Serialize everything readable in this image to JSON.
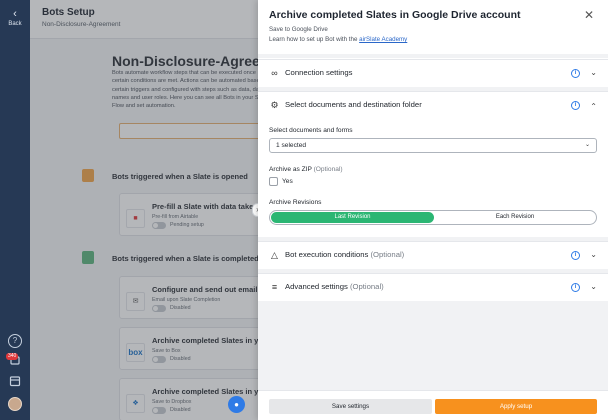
{
  "rail": {
    "back_label": "Back",
    "notif_count": "340"
  },
  "page": {
    "title": "Bots Setup",
    "subtitle": "Non-Disclosure-Agreement",
    "intro_title": "Non-Disclosure-Agreement",
    "intro_text": "Bots automate workflow steps that can be executed once certain conditions are met. Actions can be automated based on certain triggers and configured with steps such as data, dates, names and user roles. Here you can see all Bots in your Slate Flow and set automation.",
    "add_button": "Ad"
  },
  "triggers": [
    {
      "label": "Bots triggered when a Slate is opened",
      "color": "#f2a54a"
    },
    {
      "label": "Bots triggered when a Slate is completed",
      "color": "#5db57e"
    }
  ],
  "bots": [
    {
      "name": "Pre-fill a Slate with data taken",
      "desc": "Pre-fill from Airtable",
      "status": "Pending setup",
      "icon": "airtable-icon"
    },
    {
      "name": "Configure and send out email",
      "desc": "Email upon Slate Completion",
      "status": "Disabled",
      "icon": "mail-icon"
    },
    {
      "name": "Archive completed Slates in yo",
      "desc": "Save to Box",
      "status": "Disabled",
      "icon": "box-icon",
      "icon_text": "box"
    },
    {
      "name": "Archive completed Slates in yo",
      "desc": "Save to Dropbox",
      "status": "Disabled",
      "icon": "dropbox-icon"
    }
  ],
  "drawer": {
    "title": "Archive completed Slates in Google Drive account",
    "subtitle": "Save to Google Drive",
    "learn_prefix": "Learn how to set up Bot with the ",
    "learn_link": "airSlate Academy",
    "sections": {
      "connection": "Connection settings",
      "select_docs": "Select documents and destination folder",
      "bot_exec": "Bot execution conditions",
      "bot_exec_opt": "(Optional)",
      "advanced": "Advanced settings",
      "advanced_opt": "(Optional)"
    },
    "fields": {
      "select_label": "Select documents and forms",
      "select_value": "1 selected",
      "zip_label": "Archive as ZIP",
      "zip_opt": "(Optional)",
      "zip_checkbox": "Yes",
      "revisions_label": "Archive Revisions",
      "revision_on": "Last Revision",
      "revision_off": "Each Revision"
    },
    "footer": {
      "save": "Save settings",
      "apply": "Apply setup"
    }
  },
  "colors": {
    "rail": "#263955",
    "accent_green": "#2bb673",
    "accent_orange": "#f7911e",
    "info_blue": "#2f7be6"
  }
}
